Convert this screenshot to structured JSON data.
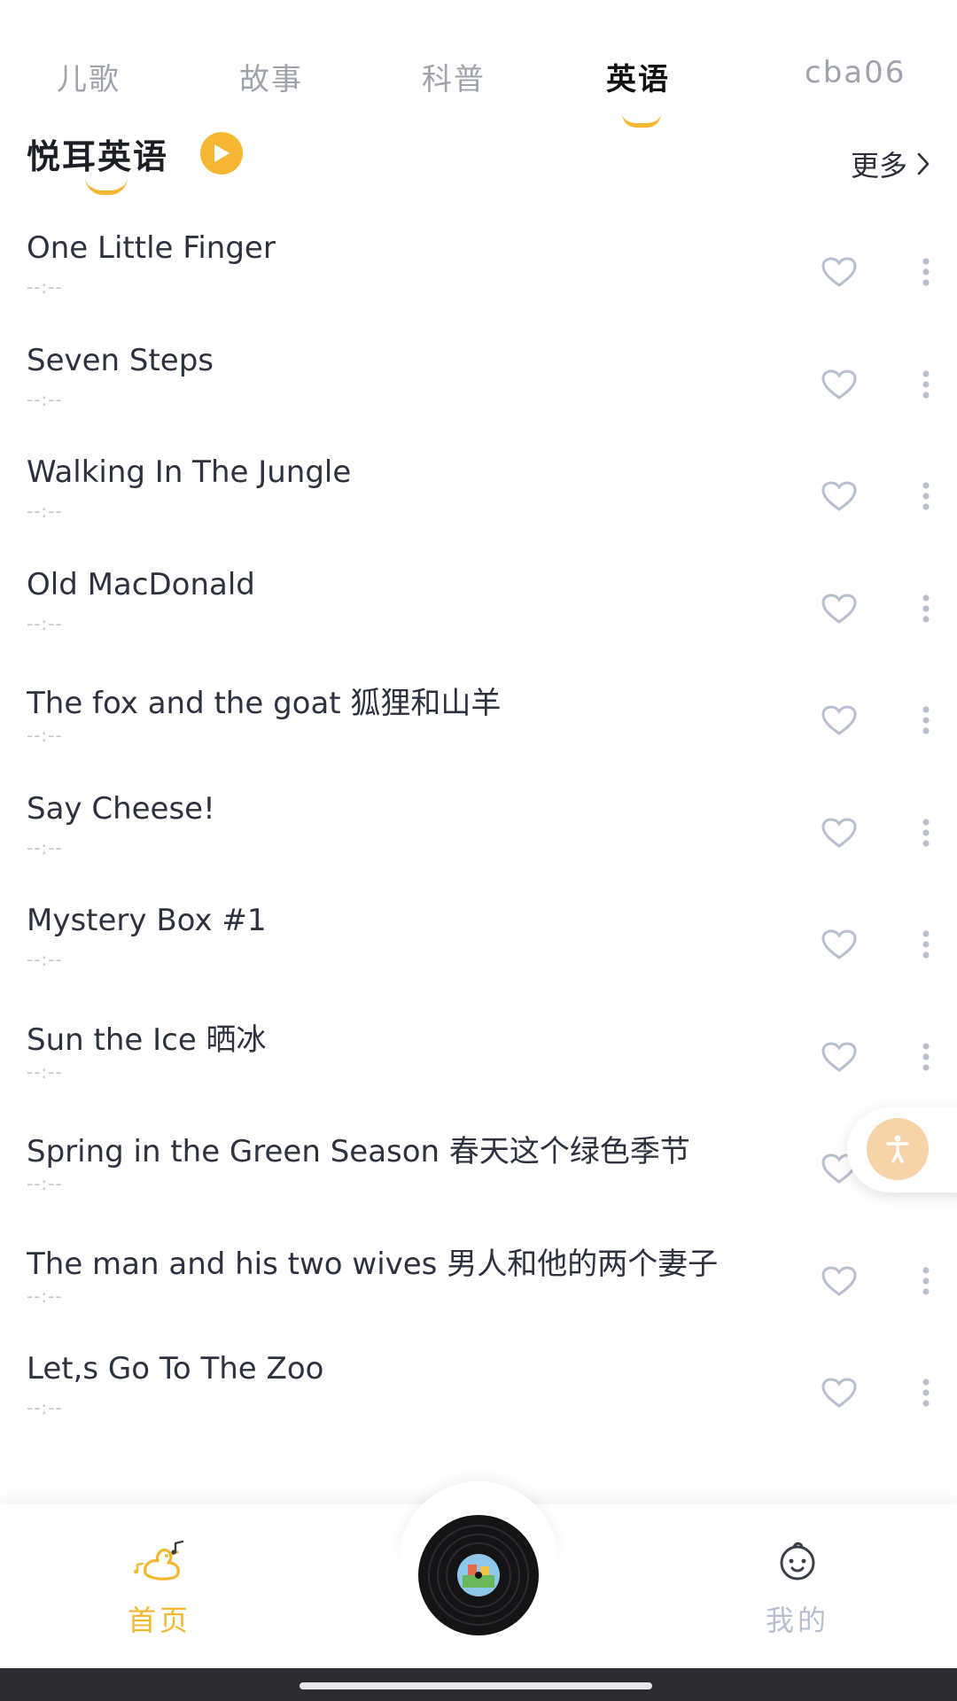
{
  "tabs": [
    {
      "label": "儿歌"
    },
    {
      "label": "故事"
    },
    {
      "label": "科普"
    },
    {
      "label": "英语"
    },
    {
      "label": "cba06"
    }
  ],
  "active_tab": "英语",
  "section": {
    "title": "悦耳英语",
    "more_label": "更多"
  },
  "songs": [
    {
      "title": "One Little Finger",
      "duration": "--:--"
    },
    {
      "title": "Seven Steps",
      "duration": "--:--"
    },
    {
      "title": "Walking In The Jungle",
      "duration": "--:--"
    },
    {
      "title": "Old MacDonald",
      "duration": "--:--"
    },
    {
      "title": "The fox and the goat 狐狸和山羊",
      "duration": "--:--"
    },
    {
      "title": "Say Cheese!",
      "duration": "--:--"
    },
    {
      "title": "Mystery Box #1",
      "duration": "--:--"
    },
    {
      "title": "Sun the Ice 晒冰",
      "duration": "--:--"
    },
    {
      "title": "Spring in the Green Season 春天这个绿色季节",
      "duration": "--:--"
    },
    {
      "title": "The man and his two wives 男人和他的两个妻子",
      "duration": "--:--"
    },
    {
      "title": "Let,s Go To The Zoo",
      "duration": "--:--"
    }
  ],
  "bottom_nav": {
    "home_label": "首页",
    "mine_label": "我的"
  },
  "colors": {
    "accent": "#f5b731",
    "inactive_tab": "#9ea3ad",
    "icon_outline": "#b7bfd0"
  },
  "icons": {
    "play": "play-circle-icon",
    "favorite": "heart-outline-icon",
    "more": "vertical-dots-icon",
    "home": "duck-music-icon",
    "mine": "baby-face-icon",
    "player": "vinyl-record-icon",
    "accessibility": "accessibility-person-icon"
  }
}
